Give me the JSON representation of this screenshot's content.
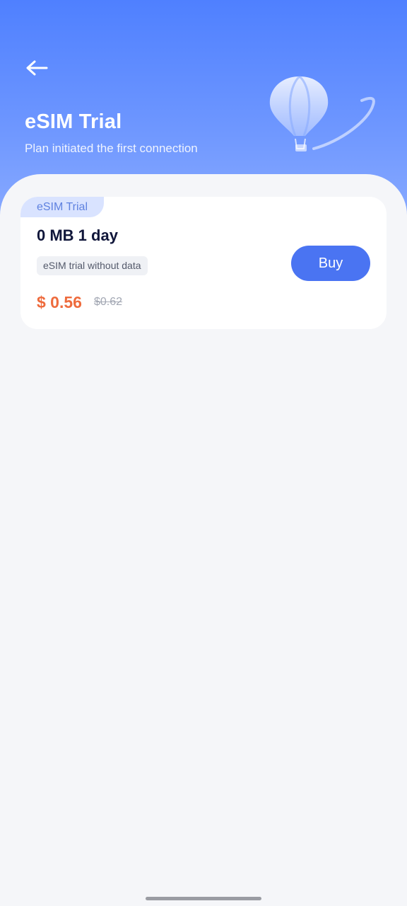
{
  "header": {
    "title": "eSIM Trial",
    "subtitle": "Plan initiated the first connection",
    "back_icon": "arrow-left-icon",
    "illustration_icon": "hot-air-balloon-icon",
    "gradient_top": "#4f80ff",
    "gradient_bottom": "#8aabff"
  },
  "plan_card": {
    "tag": "eSIM Trial",
    "name": "0 MB 1 day",
    "description": "eSIM trial without data",
    "price": "$ 0.56",
    "original_price": "$0.62",
    "buy_label": "Buy",
    "accent_color": "#4a74f2",
    "price_color": "#ee6b3d"
  }
}
